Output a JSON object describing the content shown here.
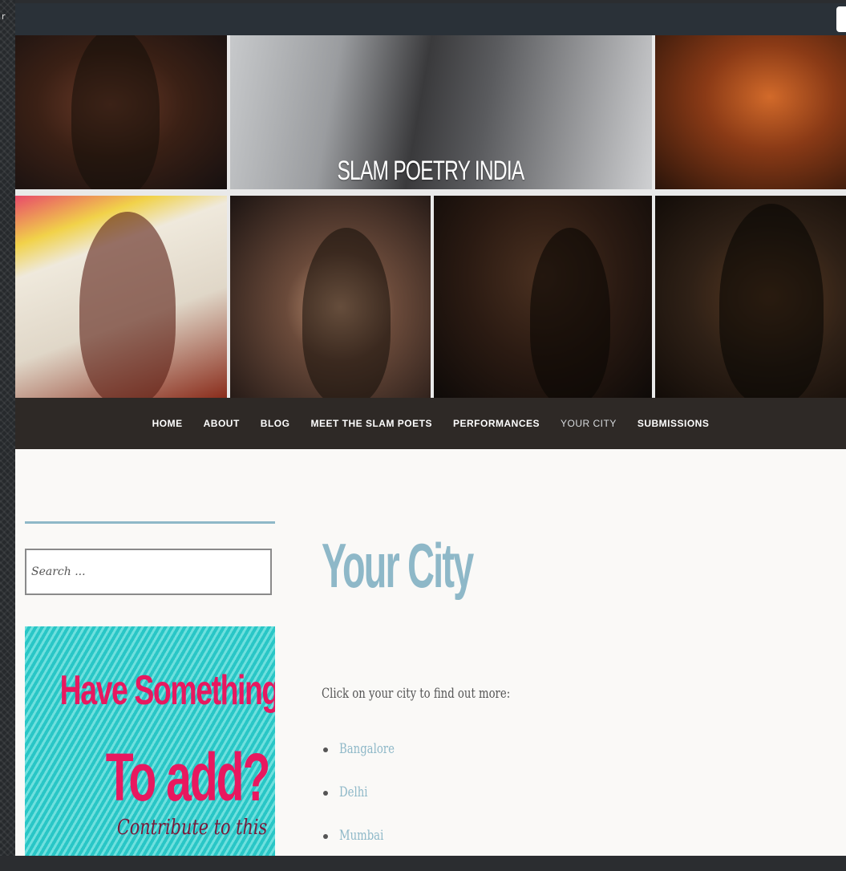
{
  "header": {
    "site_title": "SLAM POETRY INDIA"
  },
  "nav": {
    "items": [
      {
        "label": "HOME"
      },
      {
        "label": "ABOUT"
      },
      {
        "label": "BLOG"
      },
      {
        "label": "MEET THE SLAM POETS"
      },
      {
        "label": "PERFORMANCES"
      },
      {
        "label": "YOUR CITY",
        "current": true
      },
      {
        "label": "SUBMISSIONS"
      }
    ]
  },
  "sidebar": {
    "search": {
      "placeholder": "Search ..."
    },
    "promo": {
      "line1": "Have Something",
      "line2": "To add?",
      "line3": "Contribute to this"
    }
  },
  "main": {
    "title": "Your City",
    "intro": "Click on your city to find out more:",
    "cities": [
      {
        "name": "Bangalore"
      },
      {
        "name": "Delhi"
      },
      {
        "name": "Mumbai"
      }
    ]
  },
  "colors": {
    "accent": "#8eb8c8",
    "nav_bg": "#2e2926",
    "promo_pink": "#e8185f",
    "promo_teal": "#29c6c6"
  }
}
